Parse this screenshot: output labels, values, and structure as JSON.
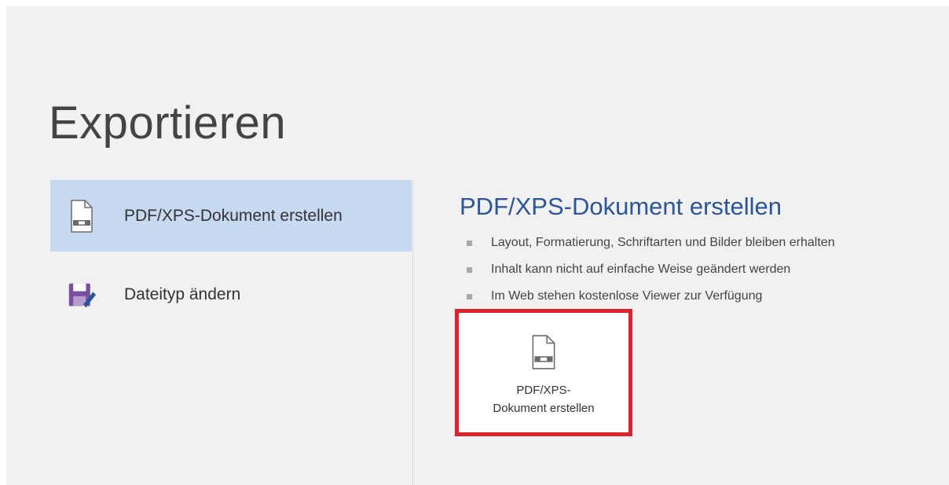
{
  "page": {
    "title": "Exportieren"
  },
  "nav": {
    "items": [
      {
        "label": "PDF/XPS-Dokument erstellen",
        "icon": "pdf-document-icon",
        "selected": true
      },
      {
        "label": "Dateityp ändern",
        "icon": "save-as-icon",
        "selected": false
      }
    ]
  },
  "detail": {
    "title": "PDF/XPS-Dokument erstellen",
    "bullets": [
      "Layout, Formatierung, Schriftarten und Bilder bleiben erhalten",
      "Inhalt kann nicht auf einfache Weise geändert werden",
      "Im Web stehen kostenlose Viewer zur Verfügung"
    ],
    "button": {
      "line1": "PDF/XPS-",
      "line2": "Dokument erstellen",
      "icon": "pdf-document-icon"
    }
  },
  "colors": {
    "accent_blue": "#2b579a",
    "selected_bg": "#c6d9f1",
    "highlight_red": "#e0202b",
    "save_icon_purple": "#7a4fa3"
  }
}
